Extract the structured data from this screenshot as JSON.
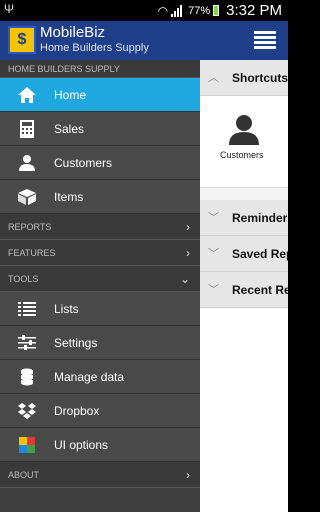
{
  "status_bar": {
    "battery": "77%",
    "time": "3:32 PM"
  },
  "app_bar": {
    "title": "MobileBiz",
    "subtitle": "Home Builders Supply",
    "logo_char": "$"
  },
  "drawer": {
    "header": "HOME BUILDERS SUPPLY",
    "items": [
      {
        "label": "Home",
        "icon": "home-icon",
        "active": true
      },
      {
        "label": "Sales",
        "icon": "calculator-icon"
      },
      {
        "label": "Customers",
        "icon": "person-icon"
      },
      {
        "label": "Items",
        "icon": "box-icon"
      }
    ],
    "reports": "REPORTS",
    "features": "FEATURES",
    "tools": "TOOLS",
    "tool_items": [
      {
        "label": "Lists",
        "icon": "list-icon"
      },
      {
        "label": "Settings",
        "icon": "sliders-icon"
      },
      {
        "label": "Manage data",
        "icon": "database-icon"
      },
      {
        "label": "Dropbox",
        "icon": "dropbox-icon"
      },
      {
        "label": "UI options",
        "icon": "palette-icon"
      }
    ],
    "about": "ABOUT"
  },
  "content": {
    "shortcuts_title": "Shortcuts",
    "shortcut_customers": "Customers",
    "reminders_title": "Reminders",
    "saved_reports_title": "Saved Reports",
    "recent_reports_title": "Recent Reports"
  },
  "colors": {
    "accent": "#1fa8e0",
    "app_bar": "#1f3f8a",
    "drawer_bg": "#404040"
  }
}
